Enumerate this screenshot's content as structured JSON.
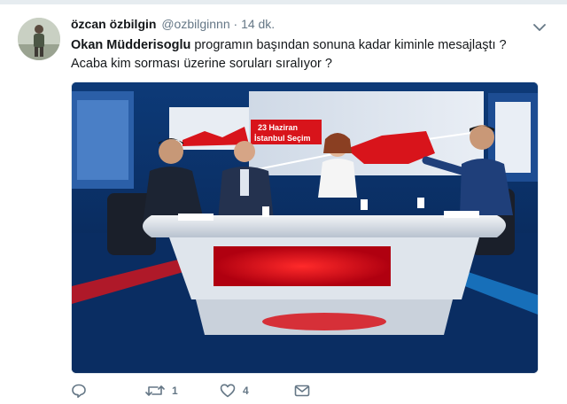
{
  "tweet": {
    "author_name": "özcan özbilgin",
    "author_handle": "@ozbilginnn",
    "separator": "·",
    "time": "14 dk.",
    "mention": "Okan Müdderisoglu",
    "text_line1_rest": " programın başından sonuna kadar  kiminle mesajlaştı ?",
    "text_line2": "Acaba kim sorması üzerine soruları sıralıyor ?"
  },
  "media": {
    "screen_text_line1": "23 Haziran",
    "screen_text_line2": "İstanbul Seçim"
  },
  "actions": {
    "reply_count": "",
    "retweet_count": "1",
    "like_count": "4"
  },
  "colors": {
    "text": "#14171a",
    "secondary": "#657786",
    "studio_blue": "#0a2a5a",
    "studio_red": "#d8141b"
  },
  "icons": [
    "chevron-down-icon",
    "reply-icon",
    "retweet-icon",
    "like-icon",
    "direct-message-icon"
  ]
}
